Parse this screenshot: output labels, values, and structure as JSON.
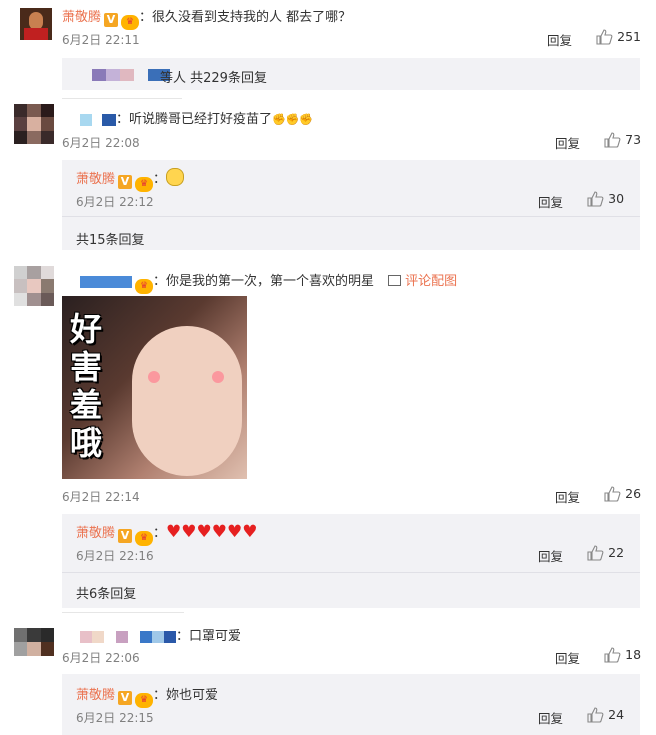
{
  "comments": [
    {
      "name": "萧敬腾",
      "text": "：很久没看到支持我的人 都去了哪？",
      "time": "6月2日 22:11",
      "reply": "回复",
      "likes": "251",
      "summary": "等人 共229条回复"
    },
    {
      "text": "：听说腾哥已经打好疫苗了",
      "time": "6月2日 22:08",
      "reply": "回复",
      "likes": "73",
      "sub": {
        "name": "萧敬腾",
        "text": "：",
        "time": "6月2日 22:12",
        "reply": "回复",
        "likes": "30",
        "more": "共15条回复"
      }
    },
    {
      "text": "：你是我的第一次，第一个喜欢的明星",
      "pic_link": "评论配图",
      "pic_caption": "好害羞哦",
      "time": "6月2日 22:14",
      "reply": "回复",
      "likes": "26",
      "sub": {
        "name": "萧敬腾",
        "text": "：",
        "time": "6月2日 22:16",
        "reply": "回复",
        "likes": "22",
        "more": "共6条回复"
      }
    },
    {
      "text": "：口罩可爱",
      "time": "6月2日 22:06",
      "reply": "回复",
      "likes": "18",
      "sub": {
        "name": "萧敬腾",
        "text": "：妳也可爱",
        "time": "6月2日 22:15",
        "reply": "回复",
        "likes": "24"
      }
    }
  ],
  "colors": {
    "name": "#eb7350",
    "subbg": "#f2f2f5",
    "link": "#eb7350"
  }
}
